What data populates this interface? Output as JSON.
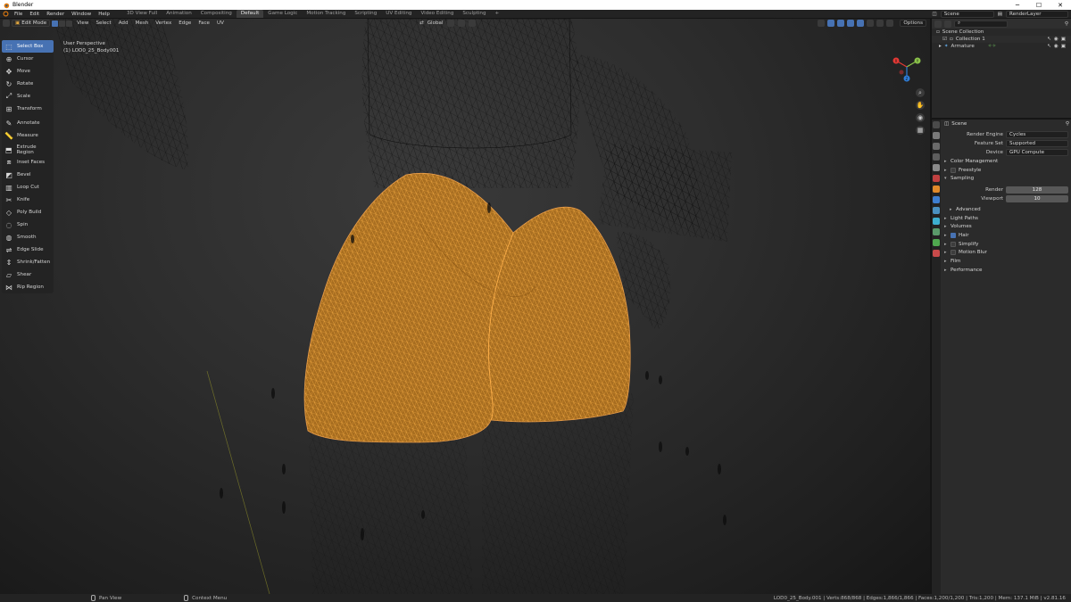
{
  "window": {
    "title": "Blender",
    "controls": [
      "─",
      "☐",
      "✕"
    ]
  },
  "topbar": {
    "menus": [
      "File",
      "Edit",
      "Render",
      "Window",
      "Help"
    ],
    "workspaces": [
      "3D View Full",
      "Animation",
      "Compositing",
      "Default",
      "Game Logic",
      "Motion Tracking",
      "Scripting",
      "UV Editing",
      "Video Editing",
      "Sculpting"
    ],
    "active_workspace": "Default",
    "add_tab": "+",
    "scene": "Scene",
    "view_layer": "RenderLayer"
  },
  "viewport": {
    "mode": "Edit Mode",
    "menus": [
      "View",
      "Select",
      "Add",
      "Mesh",
      "Vertex",
      "Edge",
      "Face",
      "UV"
    ],
    "transform_orientation": "Global",
    "options_label": "Options",
    "view_name": "User Perspective",
    "object_name": "(1) LOD0_25_Body001",
    "tools": [
      {
        "label": "Select Box",
        "icon": "select-box-icon",
        "active": true
      },
      {
        "label": "Cursor",
        "icon": "cursor-icon"
      },
      {
        "label": "Move",
        "icon": "move-icon"
      },
      {
        "label": "Rotate",
        "icon": "rotate-icon"
      },
      {
        "label": "Scale",
        "icon": "scale-icon"
      },
      {
        "label": "Transform",
        "icon": "transform-icon"
      },
      {
        "label": "Annotate",
        "icon": "annotate-icon"
      },
      {
        "label": "Measure",
        "icon": "measure-icon"
      },
      {
        "label": "Extrude Region",
        "icon": "extrude-icon"
      },
      {
        "label": "Inset Faces",
        "icon": "inset-icon"
      },
      {
        "label": "Bevel",
        "icon": "bevel-icon"
      },
      {
        "label": "Loop Cut",
        "icon": "loop-cut-icon"
      },
      {
        "label": "Knife",
        "icon": "knife-icon"
      },
      {
        "label": "Poly Build",
        "icon": "poly-build-icon"
      },
      {
        "label": "Spin",
        "icon": "spin-icon"
      },
      {
        "label": "Smooth",
        "icon": "smooth-icon"
      },
      {
        "label": "Edge Slide",
        "icon": "edge-slide-icon"
      },
      {
        "label": "Shrink/Fatten",
        "icon": "shrink-fatten-icon"
      },
      {
        "label": "Shear",
        "icon": "shear-icon"
      },
      {
        "label": "Rip Region",
        "icon": "rip-icon"
      }
    ],
    "gizmo": {
      "x": "X",
      "y": "Y",
      "z": "Z"
    }
  },
  "outliner": {
    "root": "Scene Collection",
    "items": [
      {
        "label": "Collection 1"
      },
      {
        "label": "Armature"
      }
    ]
  },
  "properties": {
    "context": "Scene",
    "render_engine_label": "Render Engine",
    "render_engine": "Cycles",
    "feature_set_label": "Feature Set",
    "feature_set": "Supported",
    "device_label": "Device",
    "device": "GPU Compute",
    "panels": {
      "color_management": "Color Management",
      "freestyle": "Freestyle",
      "sampling": "Sampling",
      "render_label": "Render",
      "render_samples": "128",
      "viewport_label": "Viewport",
      "viewport_samples": "10",
      "advanced": "Advanced",
      "light_paths": "Light Paths",
      "volumes": "Volumes",
      "hair": "Hair",
      "simplify": "Simplify",
      "motion_blur": "Motion Blur",
      "film": "Film",
      "performance": "Performance"
    }
  },
  "statusbar": {
    "pan_view": "Pan View",
    "context_menu": "Context Menu",
    "stats": "LOD0_25_Body.001 | Verts:868/868 | Edges:1,866/1,866 | Faces:1,200/1,200 | Tris:1,200 | Mem: 137.1 MiB | v2.81.16"
  },
  "colors": {
    "accent": "#4772b3",
    "selection": "#f0a040",
    "wire": "#050505"
  }
}
